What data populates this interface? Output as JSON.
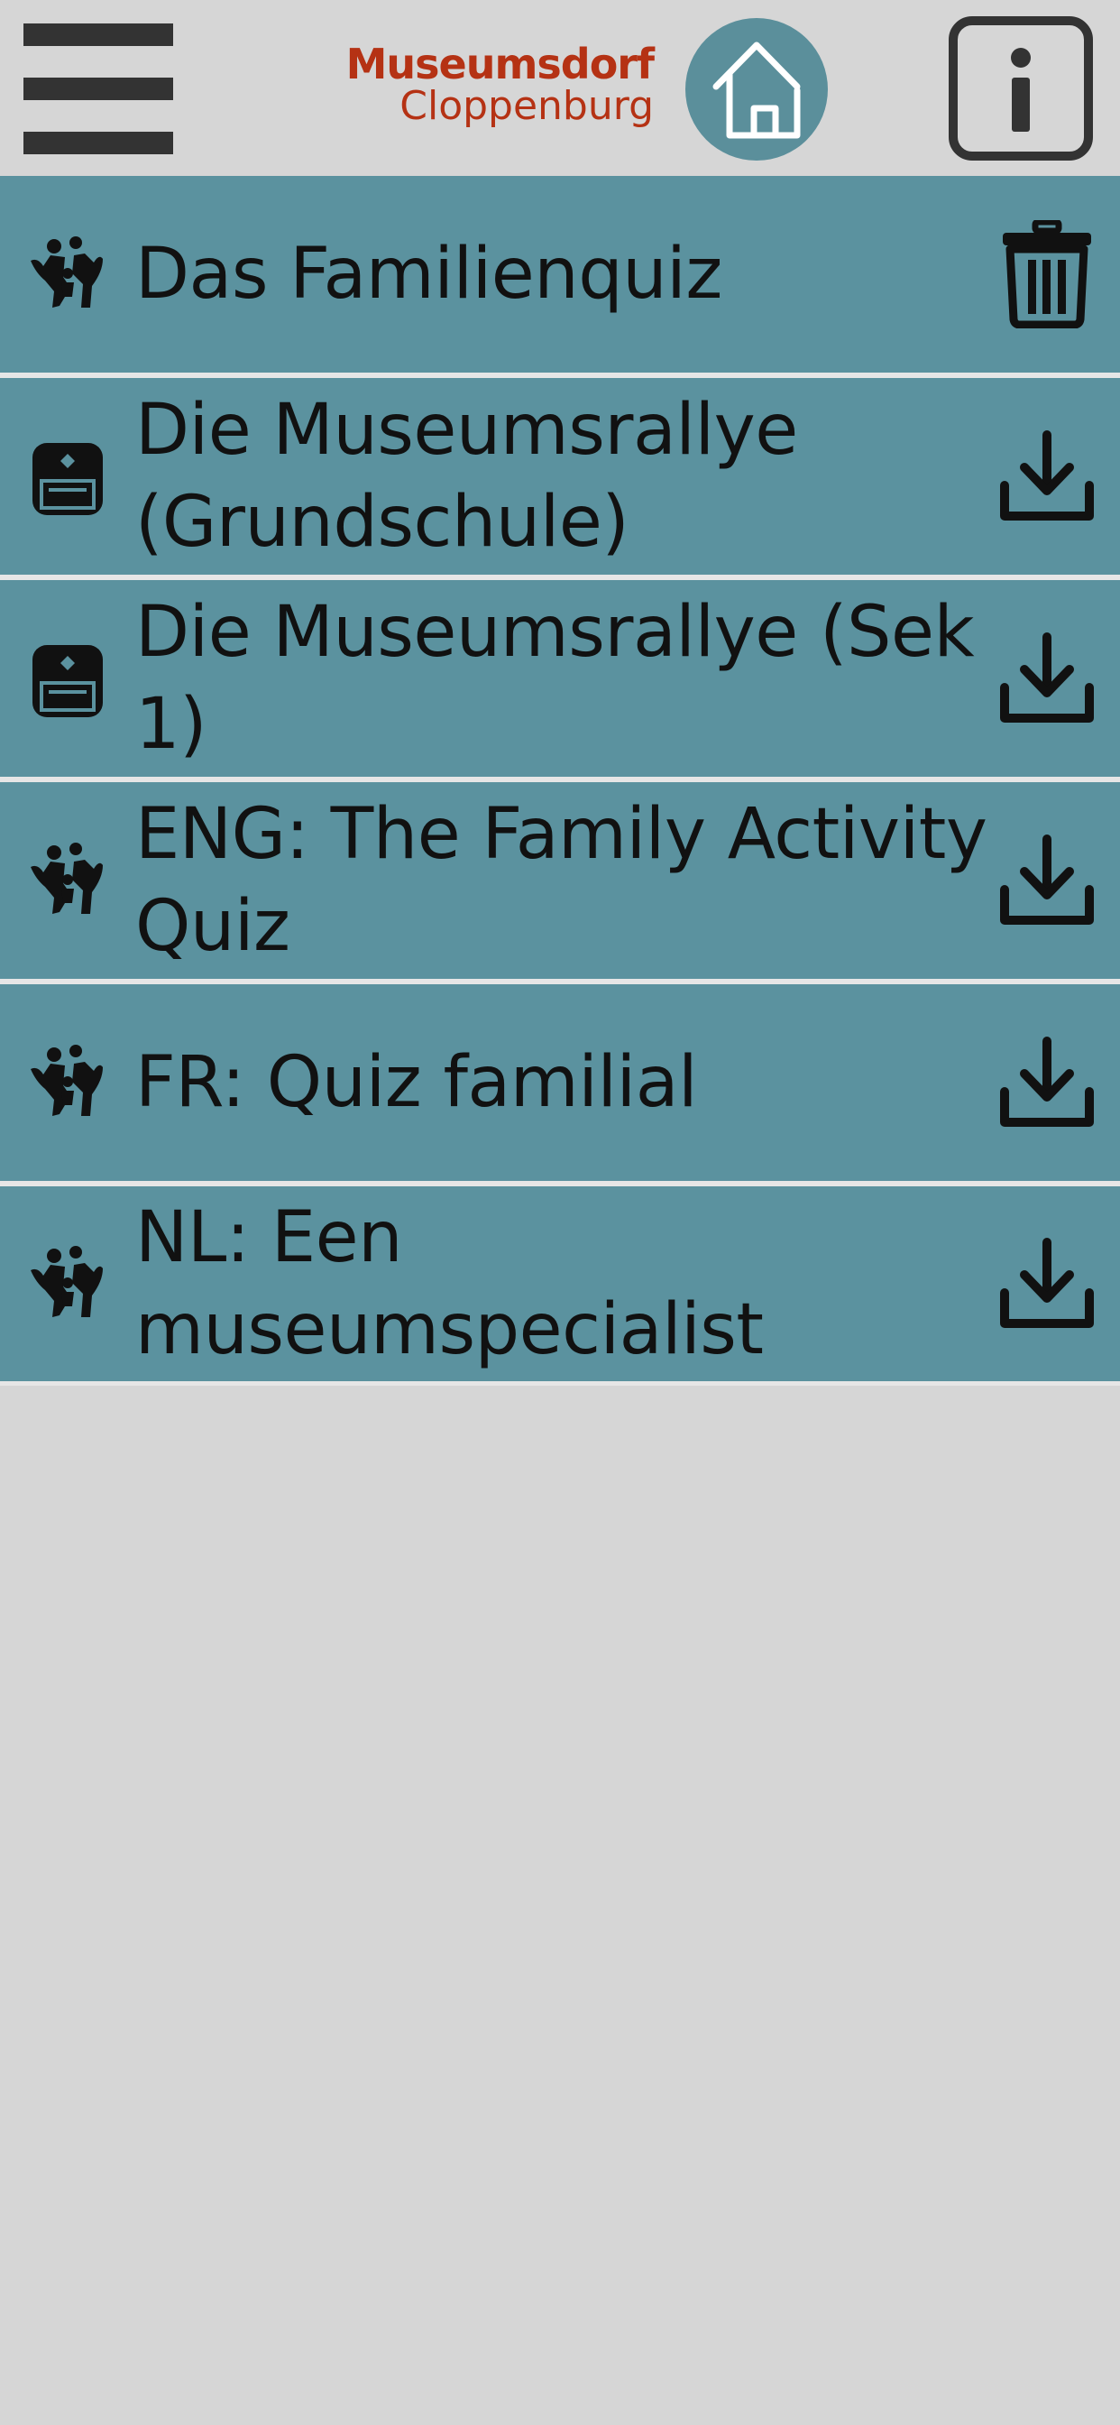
{
  "header": {
    "logo_line1": "Museumsdorf",
    "logo_line2": "Cloppenburg",
    "menu_icon": "hamburger-menu-icon",
    "home_icon": "home-icon",
    "info_icon": "info-icon",
    "brand_color": "#b53214",
    "accent_color": "#5b8f9b"
  },
  "quizzes": [
    {
      "title": "Das Familienquiz",
      "type_icon": "family-icon",
      "action_icon": "trash-icon"
    },
    {
      "title": "Die Museumsrallye (Grundschule)",
      "type_icon": "backpack-icon",
      "action_icon": "download-icon"
    },
    {
      "title": "Die Museumsrallye (Sek 1)",
      "type_icon": "backpack-icon",
      "action_icon": "download-icon"
    },
    {
      "title": "ENG: The Family Activity Quiz",
      "type_icon": "family-icon",
      "action_icon": "download-icon"
    },
    {
      "title": "FR: Quiz familial",
      "type_icon": "family-icon",
      "action_icon": "download-icon"
    },
    {
      "title": "NL: Een museumspecialist",
      "type_icon": "family-icon",
      "action_icon": "download-icon"
    }
  ],
  "colors": {
    "row_background": "#5b929f",
    "page_background": "#d6d6d6",
    "separator": "#e6e6e6"
  }
}
